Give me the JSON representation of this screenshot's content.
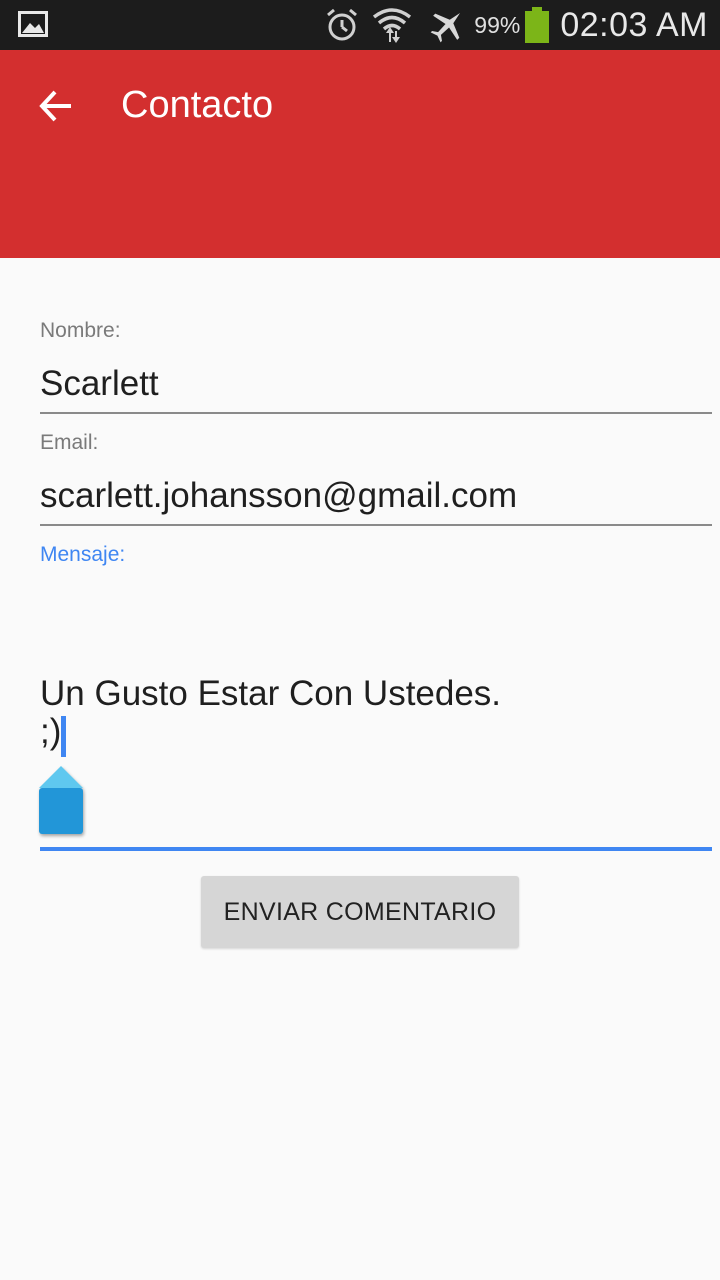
{
  "status_bar": {
    "icons": [
      "gallery-icon",
      "alarm-icon",
      "wifi-icon",
      "airplane-icon",
      "battery-icon"
    ],
    "battery": "99%",
    "time": "02:03 AM"
  },
  "app_bar": {
    "back_icon": "arrow-back-icon",
    "title": "Contacto",
    "color": "#d32f2f"
  },
  "form": {
    "name": {
      "label": "Nombre:",
      "value": "Scarlett"
    },
    "email": {
      "label": "Email:",
      "value": "scarlett.johansson@gmail.com"
    },
    "message": {
      "label": "Mensaje:",
      "value": "Un Gusto Estar Con Ustedes.\n;)"
    },
    "submit_label": "ENVIAR COMENTARIO",
    "accent": "#3f86f2"
  }
}
